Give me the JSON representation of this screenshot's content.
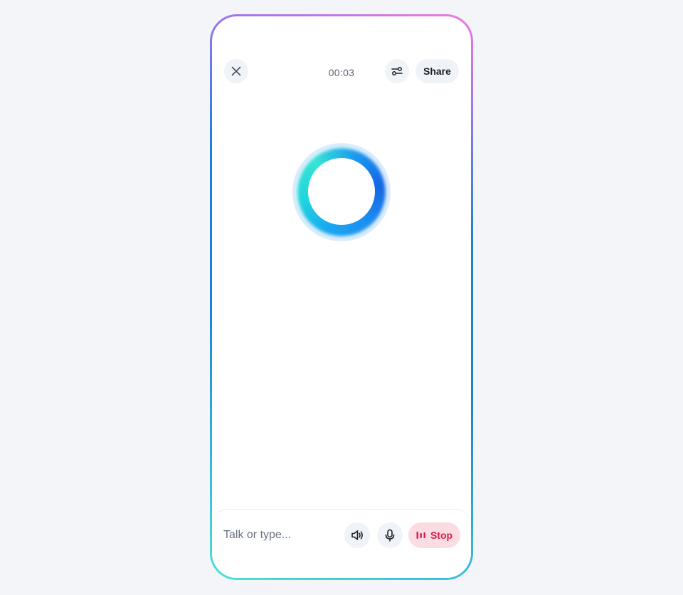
{
  "header": {
    "timer": "00:03",
    "share_label": "Share"
  },
  "composer": {
    "placeholder": "Talk or type...",
    "stop_label": "Stop"
  },
  "icons": {
    "close": "close-icon",
    "settings": "sliders-icon",
    "speaker": "speaker-icon",
    "mic": "microphone-icon",
    "stop": "audio-bars-icon"
  },
  "colors": {
    "accent_blue": "#1c7fd8",
    "accent_pink": "#f07ad8",
    "accent_teal": "#4fdfd6",
    "stop_text": "#d81c4e",
    "stop_bg": "#fcdce3"
  }
}
